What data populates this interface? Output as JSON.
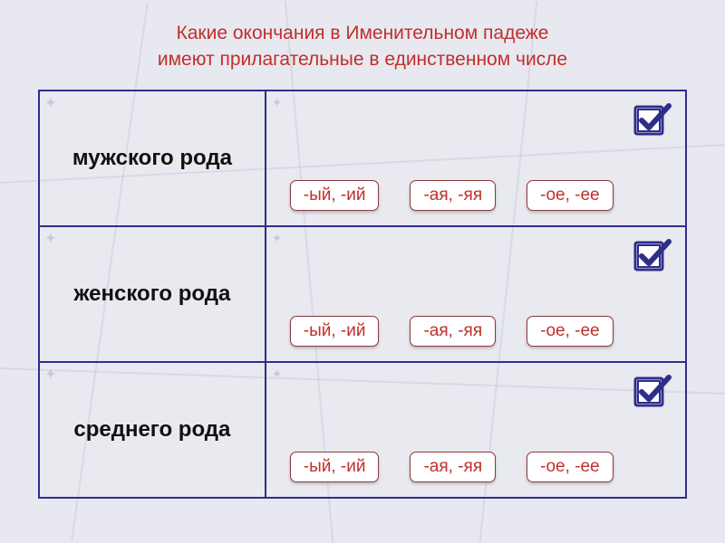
{
  "question": {
    "line1": "Какие окончания в Именительном падеже",
    "line2": "имеют прилагательные в единственном числе"
  },
  "rows": [
    {
      "label": "мужского рода",
      "options": [
        "-ый, -ий",
        "-ая, -яя",
        "-ое, -ее"
      ]
    },
    {
      "label": "женского рода",
      "options": [
        "-ый, -ий",
        "-ая, -яя",
        "-ое, -ее"
      ]
    },
    {
      "label": "среднего рода",
      "options": [
        "-ый, -ий",
        "-ая, -яя",
        "-ое, -ее"
      ]
    }
  ]
}
